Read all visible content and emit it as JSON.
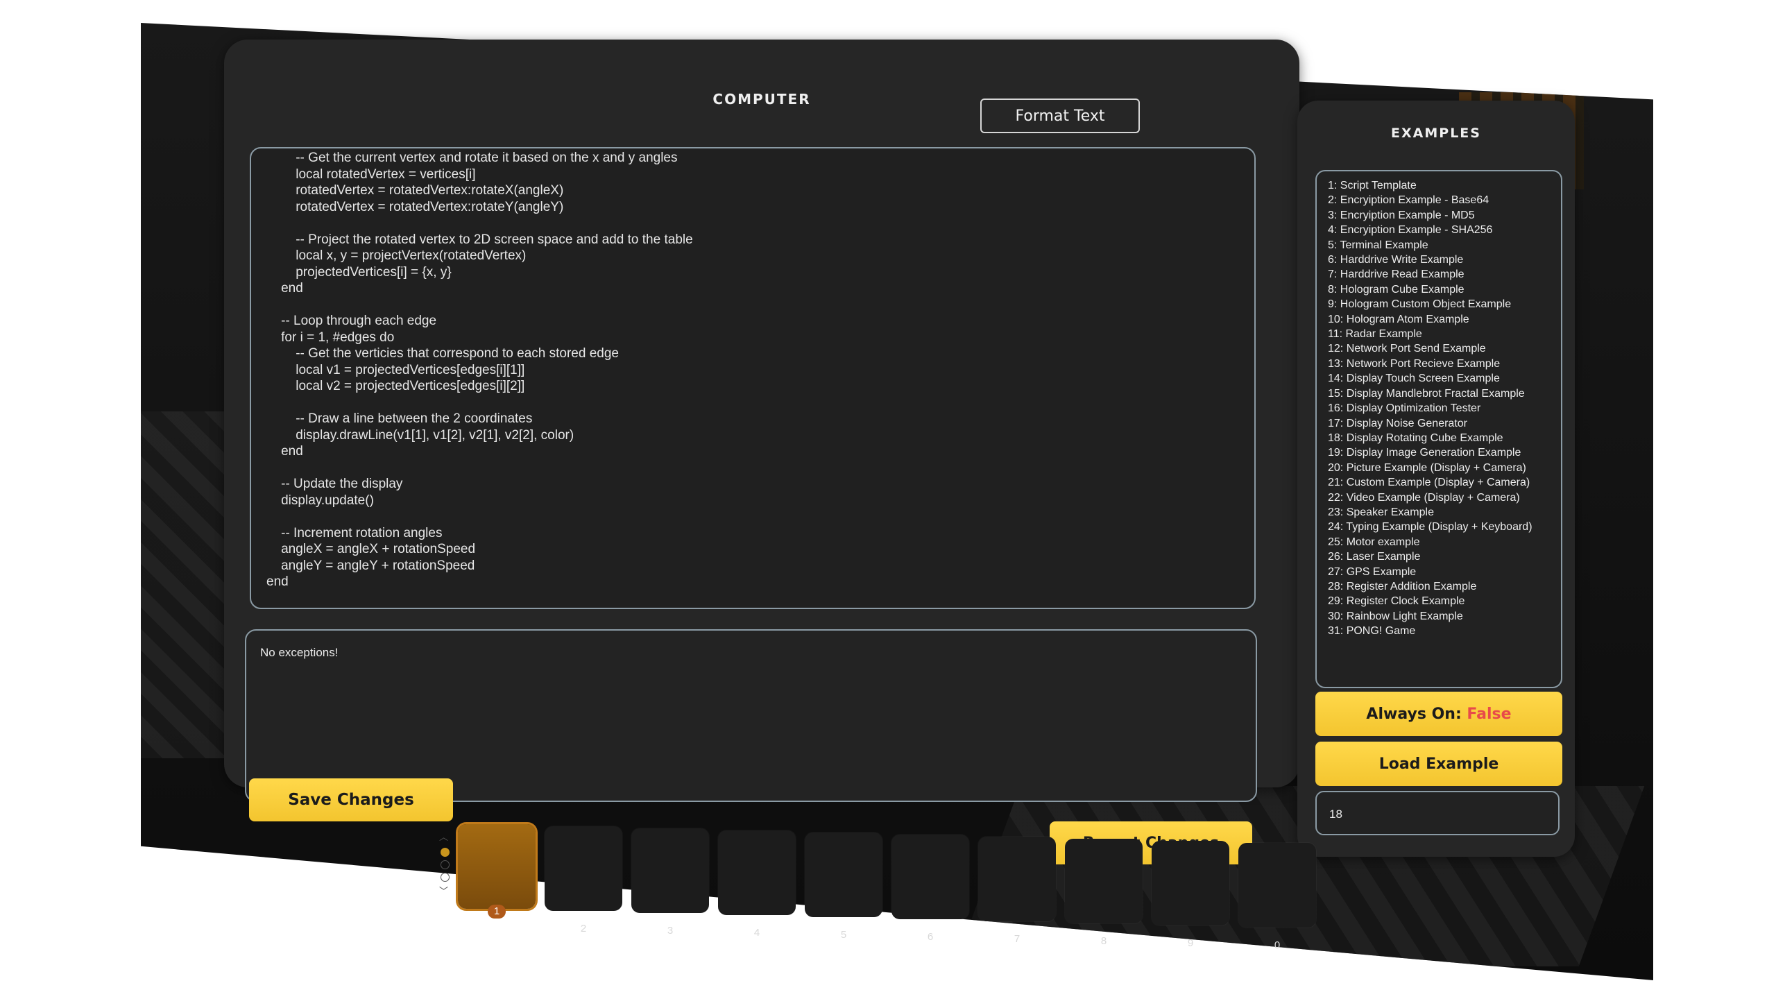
{
  "computer": {
    "title": "COMPUTER",
    "format_button": "Format Text",
    "code_lines": [
      "        -- Get the current vertex and rotate it based on the x and y angles",
      "        local rotatedVertex = vertices[i]",
      "        rotatedVertex = rotatedVertex:rotateX(angleX)",
      "        rotatedVertex = rotatedVertex:rotateY(angleY)",
      "",
      "        -- Project the rotated vertex to 2D screen space and add to the table",
      "        local x, y = projectVertex(rotatedVertex)",
      "        projectedVertices[i] = {x, y}",
      "    end",
      "",
      "    -- Loop through each edge",
      "    for i = 1, #edges do",
      "        -- Get the verticies that correspond to each stored edge",
      "        local v1 = projectedVertices[edges[i][1]]",
      "        local v2 = projectedVertices[edges[i][2]]",
      "",
      "        -- Draw a line between the 2 coordinates",
      "        display.drawLine(v1[1], v1[2], v2[1], v2[2], color)",
      "    end",
      "",
      "    -- Update the display",
      "    display.update()",
      "",
      "    -- Increment rotation angles",
      "    angleX = angleX + rotationSpeed",
      "    angleY = angleY + rotationSpeed",
      "end"
    ],
    "exception_text": "No exceptions!",
    "save_button": "Save Changes",
    "revert_button": "Revert Changes"
  },
  "examples": {
    "title": "EXAMPLES",
    "items": [
      "1: Script Template",
      "2: Encryiption Example - Base64",
      "3: Encryiption Example - MD5",
      "4: Encryiption Example - SHA256",
      "5: Terminal Example",
      "6: Harddrive Write Example",
      "7: Harddrive Read Example",
      "8: Hologram Cube Example",
      "9: Hologram Custom Object Example",
      "10: Hologram Atom Example",
      "11: Radar Example",
      "12: Network Port Send Example",
      "13: Network Port Recieve Example",
      "14: Display Touch Screen Example",
      "15: Display Mandlebrot Fractal Example",
      "16: Display Optimization Tester",
      "17: Display Noise Generator",
      "18: Display Rotating Cube Example",
      "19: Display Image Generation Example",
      "20: Picture Example (Display + Camera)",
      "21: Custom Example (Display + Camera)",
      "22: Video Example (Display + Camera)",
      "23: Speaker Example",
      "24: Typing Example (Display + Keyboard)",
      "25: Motor example",
      "26: Laser Example",
      "27: GPS Example",
      "28: Register Addition Example",
      "29: Register Clock Example",
      "30: Rainbow Light Example",
      "31: PONG! Game"
    ],
    "always_on_label": "Always On:",
    "always_on_value": "False",
    "load_button": "Load Example",
    "example_number": "18"
  },
  "hotbar": {
    "slots": [
      "1",
      "2",
      "3",
      "4",
      "5",
      "6",
      "7",
      "8",
      "9",
      "0"
    ],
    "active_slot": "1"
  },
  "colors": {
    "accent_yellow": "#f3c52f",
    "false_red": "#e84a4a",
    "panel_bg": "#262626"
  }
}
